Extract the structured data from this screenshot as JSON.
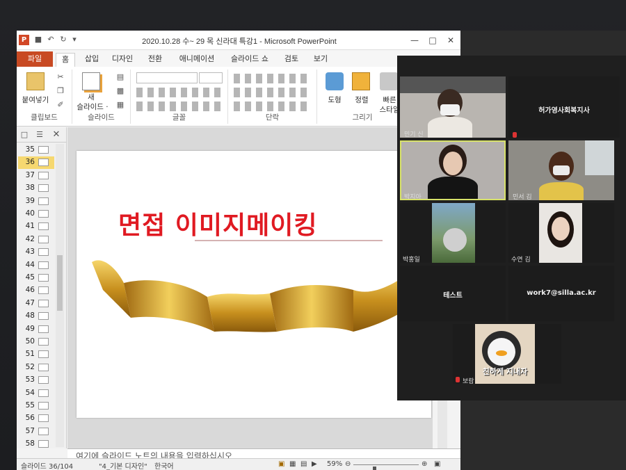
{
  "window": {
    "title": "2020.10.28 수~ 29 목  신라대 특강1 - Microsoft PowerPoint",
    "app_icon_letter": "P"
  },
  "tabs": [
    "파일",
    "홈",
    "삽입",
    "디자인",
    "전환",
    "애니메이션",
    "슬라이드 쇼",
    "검토",
    "보기"
  ],
  "ribbon": {
    "paste_label": "붙여넣기",
    "new_slide_label": "새",
    "new_slide_label2": "슬라이드 ·",
    "shapes_label": "도형",
    "arrange_label": "정렬",
    "quick_styles_label": "빠른",
    "quick_styles_label2": "스타일",
    "groups": {
      "clipboard": "클립보드",
      "slides": "슬라이드",
      "font": "글꼴",
      "paragraph": "단락",
      "drawing": "그리기"
    }
  },
  "thumbnails": {
    "items": [
      "35",
      "36",
      "37",
      "38",
      "39",
      "40",
      "41",
      "42",
      "43",
      "44",
      "45",
      "46",
      "47",
      "48",
      "49",
      "50",
      "51",
      "52",
      "53",
      "54",
      "55",
      "56",
      "57",
      "58"
    ],
    "selected": "36"
  },
  "slide": {
    "title": "면접 이미지메이킹"
  },
  "notes": {
    "placeholder": "여기에 슬라이드 노트의 내용을 입력하십시오"
  },
  "statusbar": {
    "slide_count": "슬라이드 36/104",
    "theme": "\"4_기본 디자인\"",
    "language": "한국어",
    "zoom": "59%",
    "zoom_fraction": 0.59
  },
  "conference": {
    "colors": {
      "active_border": "#d8e26a",
      "mic_off": "#dd3333"
    },
    "tiles": {
      "t1_name": "민기 신",
      "t2_center": "허가영사회복지사",
      "t3_name": "박지아",
      "t4_name": "민서 김",
      "t5_name": "박홍일",
      "t6_name": "수연 김",
      "t7_center": "테스트",
      "t8_center": "work7@silla.ac.kr",
      "t9_name": "보람",
      "t9_overlay": "친하게 지내자"
    }
  }
}
